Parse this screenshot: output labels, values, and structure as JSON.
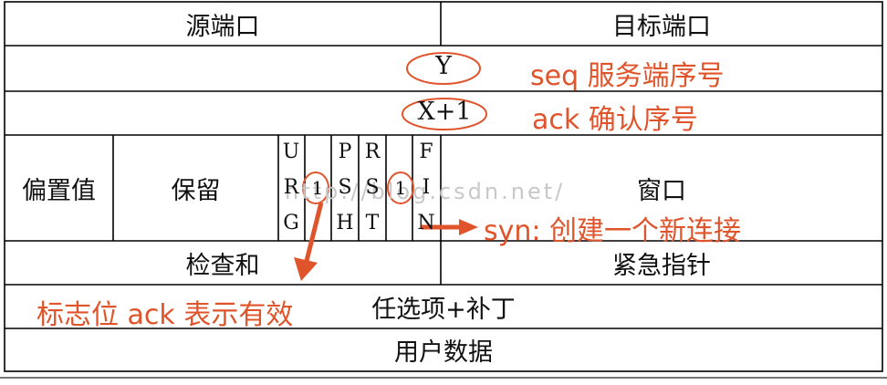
{
  "header": {
    "source_port": "源端口",
    "dest_port": "目标端口"
  },
  "seq_row": {
    "value": "Y",
    "note": "seq 服务端序号"
  },
  "ack_row": {
    "value": "X+1",
    "note": "ack 确认序号"
  },
  "control_row": {
    "offset": "偏置值",
    "reserved": "保留",
    "flags": [
      {
        "name": "URG",
        "letters": [
          "U",
          "R",
          "G"
        ],
        "mark": ""
      },
      {
        "name": "ACK",
        "letters": [
          "",
          "",
          ""
        ],
        "mark": "1"
      },
      {
        "name": "PSH",
        "letters": [
          "P",
          "S",
          "H"
        ],
        "mark": ""
      },
      {
        "name": "RST",
        "letters": [
          "R",
          "S",
          "T"
        ],
        "mark": ""
      },
      {
        "name": "SYN",
        "letters": [
          "",
          "",
          ""
        ],
        "mark": "1"
      },
      {
        "name": "FIN",
        "letters": [
          "F",
          "I",
          "N"
        ],
        "mark": ""
      }
    ],
    "window": "窗口"
  },
  "checksum_row": {
    "checksum": "检查和",
    "urgent_pointer": "紧急指针"
  },
  "options": "任选项+补丁",
  "user_data": "用户数据",
  "annotations": {
    "syn_note": "syn: 创建一个新连接",
    "ack_flag_note": "标志位 ack 表示有效"
  },
  "watermark": "http://blog.csdn.net/",
  "colors": {
    "annotation": "#e0542c",
    "lines": "#000000"
  }
}
